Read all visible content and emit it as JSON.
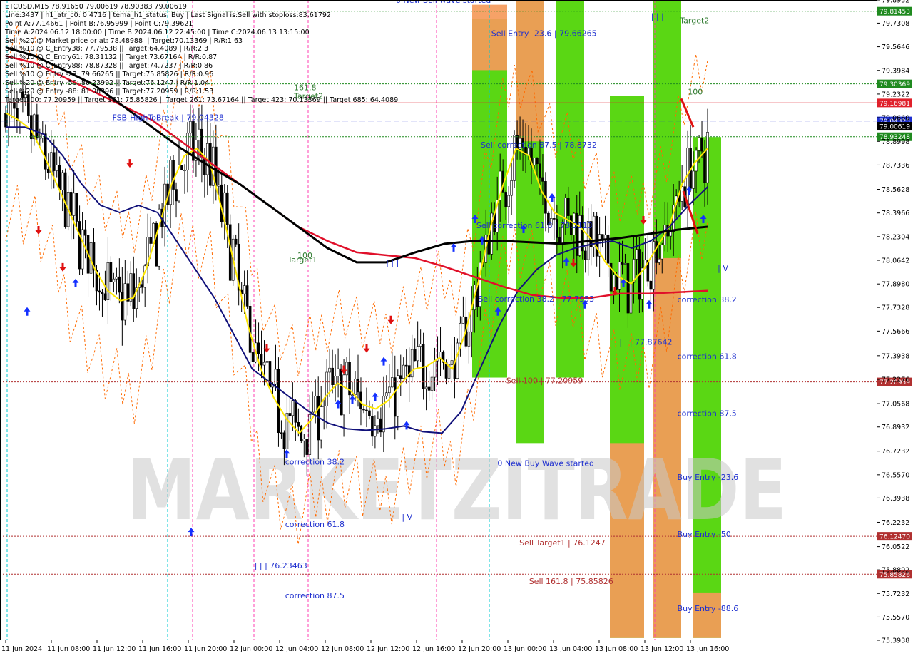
{
  "header": {
    "lines": [
      "ETCUSD,M15  78.91650 79.00619 78.90383 79.00619",
      "Line:3437 | h1_atr_c0: 0.4716 | tema_h1_status: Buy | Last Signal is:Sell with stoploss:83.61792",
      "Point A:77.14661 | Point B:76.95999 | Point C:79.39621",
      "Time A:2024.06.12 18:00:00 | Time B:2024.06.12 22:45:00 | Time C:2024.06.13 13:15:00",
      "Sell %20 @ Market price or at: 78.48988 || Target:70.13369 | R/R:1.63",
      "Sell %10 @ C_Entry38: 77.79538 || Target:64.4089 | R/R:2.3",
      "Sell %10 @ C_Entry61: 78.31132 || Target:73.67164 | R/R:0.87",
      "Sell %10 @ C_Entry88: 78.87328 || Target:74.7237 | R/R:0.86",
      "Sell %10 @ Entry -23: 79.66265 || Target:75.85826 | R/R:0.96",
      "Sell %20 @ Entry -50: 80.23992 || Target:76.1247 | R/R:1.04",
      "Sell %20 @ Entry -88: 81.08396 || Target:77.20959 | R/R:1.53",
      "Target100: 77.20959 || Target 161: 75.85826 || Target 261: 73.67164 || Target 423: 70.13369 || Target 685: 64.4089"
    ]
  },
  "top_label": "0 New Sell wave started",
  "watermark": "MARKETZITRADE",
  "chart_data": {
    "type": "candlestick",
    "symbol": "ETCUSD",
    "timeframe": "M15",
    "ylim": [
      75.3938,
      79.8932
    ],
    "y_ticks": [
      79.8932,
      79.7308,
      79.5646,
      79.3984,
      79.2322,
      79.066,
      78.8998,
      78.7336,
      78.5628,
      78.3966,
      78.2304,
      78.0642,
      77.898,
      77.7328,
      77.5666,
      77.3938,
      77.2276,
      77.0568,
      76.8932,
      76.7232,
      76.557,
      76.3938,
      76.2232,
      76.0522,
      75.8892,
      75.7232,
      75.557,
      75.3938
    ],
    "x_labels": [
      "11 Jun 2024",
      "11 Jun 08:00",
      "11 Jun 12:00",
      "11 Jun 16:00",
      "11 Jun 20:00",
      "12 Jun 00:00",
      "12 Jun 04:00",
      "12 Jun 08:00",
      "12 Jun 12:00",
      "12 Jun 16:00",
      "12 Jun 20:00",
      "13 Jun 00:00",
      "13 Jun 04:00",
      "13 Jun 08:00",
      "13 Jun 12:00",
      "13 Jun 16:00"
    ],
    "price_levels": [
      {
        "value": 79.81453,
        "label": "79.81453",
        "color": "#1f8a1f",
        "style": "dotted"
      },
      {
        "value": 79.30369,
        "label": "79.30369",
        "color": "#1f8a1f",
        "style": "dotted"
      },
      {
        "value": 79.16981,
        "label": "79.16981",
        "color": "#e0202a",
        "style": "solid"
      },
      {
        "value": 79.04328,
        "label": "79.04328",
        "color": "#1e2fcf",
        "style": "dashed"
      },
      {
        "value": 79.00619,
        "label": "79.00619",
        "color": "#000000",
        "style": "solid"
      },
      {
        "value": 78.93248,
        "label": "78.93248",
        "color": "#1f8a1f",
        "style": "dotted"
      },
      {
        "value": 77.20959,
        "label": "77.20959",
        "color": "#b03030",
        "style": "dotted"
      },
      {
        "value": 76.1247,
        "label": "76.12470",
        "color": "#b03030",
        "style": "dotted"
      },
      {
        "value": 75.85826,
        "label": "75.85826",
        "color": "#b03030",
        "style": "dotted"
      }
    ],
    "annotations": [
      {
        "text": "Sell Entry -23.6 | 79.66265",
        "x": 0.56,
        "y": 79.64,
        "color": "#1e2fcf"
      },
      {
        "text": "Sell correction 87.5 | 78.8732",
        "x": 0.548,
        "y": 78.855,
        "color": "#1e2fcf"
      },
      {
        "text": "Sell correction 61.8 | 78.3113",
        "x": 0.543,
        "y": 78.29,
        "color": "#1e2fcf"
      },
      {
        "text": "Sell correction 38.2 | 77.7953",
        "x": 0.545,
        "y": 77.775,
        "color": "#1e2fcf"
      },
      {
        "text": "Sell 100 | 77.20959",
        "x": 0.577,
        "y": 77.2,
        "color": "#b03030"
      },
      {
        "text": "Sell Target1 | 76.1247",
        "x": 0.592,
        "y": 76.06,
        "color": "#b03030"
      },
      {
        "text": "Sell 161.8 | 75.85826",
        "x": 0.603,
        "y": 75.79,
        "color": "#b03030"
      },
      {
        "text": "0 New Buy Wave started",
        "x": 0.567,
        "y": 76.62,
        "color": "#1e2fcf"
      },
      {
        "text": "correction 38.2",
        "x": 0.325,
        "y": 76.63,
        "color": "#1e2fcf"
      },
      {
        "text": "correction 61.8",
        "x": 0.325,
        "y": 76.19,
        "color": "#1e2fcf"
      },
      {
        "text": "correction 87.5",
        "x": 0.325,
        "y": 75.69,
        "color": "#1e2fcf"
      },
      {
        "text": "| | | 76.23463",
        "x": 0.29,
        "y": 75.9,
        "color": "#1e2fcf"
      },
      {
        "text": "| | | 77.87642",
        "x": 0.706,
        "y": 77.47,
        "color": "#1e2fcf"
      },
      {
        "text": "correction 38.2",
        "x": 0.772,
        "y": 77.77,
        "color": "#1e2fcf"
      },
      {
        "text": "correction 61.8",
        "x": 0.772,
        "y": 77.37,
        "color": "#1e2fcf"
      },
      {
        "text": "correction 87.5",
        "x": 0.772,
        "y": 76.97,
        "color": "#1e2fcf"
      },
      {
        "text": "Buy Entry -23.6",
        "x": 0.772,
        "y": 76.52,
        "color": "#1e2fcf"
      },
      {
        "text": "Buy Entry -50",
        "x": 0.772,
        "y": 76.12,
        "color": "#1e2fcf"
      },
      {
        "text": "Buy Entry -88.6",
        "x": 0.772,
        "y": 75.6,
        "color": "#1e2fcf"
      },
      {
        "text": "Target2",
        "x": 0.335,
        "y": 79.2,
        "color": "#2f7a2f"
      },
      {
        "text": "161.8",
        "x": 0.335,
        "y": 79.26,
        "color": "#2f7a2f"
      },
      {
        "text": "Target1",
        "x": 0.328,
        "y": 78.05,
        "color": "#2f7a2f"
      },
      {
        "text": "100",
        "x": 0.339,
        "y": 78.08,
        "color": "#2f7a2f"
      },
      {
        "text": "Target2",
        "x": 0.775,
        "y": 79.73,
        "color": "#2f7a2f"
      },
      {
        "text": "100",
        "x": 0.784,
        "y": 79.23,
        "color": "#2f7a2f"
      },
      {
        "text": "FSB-HighToBreak | 79.04328",
        "x": 0.128,
        "y": 79.05,
        "color": "#1e2fcf"
      },
      {
        "text": "| | |",
        "x": 0.44,
        "y": 78.03,
        "color": "#1e2fcf"
      },
      {
        "text": "|",
        "x": 0.272,
        "y": 77.93,
        "color": "#1e2fcf"
      },
      {
        "text": "| V",
        "x": 0.458,
        "y": 76.24,
        "color": "#1e2fcf"
      },
      {
        "text": "| | |",
        "x": 0.742,
        "y": 79.76,
        "color": "#1e2fcf"
      },
      {
        "text": "|",
        "x": 0.72,
        "y": 78.76,
        "color": "#1e2fcf"
      },
      {
        "text": "| V",
        "x": 0.818,
        "y": 77.99,
        "color": "#1e2fcf"
      }
    ],
    "series": [
      {
        "name": "",
        "color": "#ffe800",
        "values": [
          79.1,
          79.05,
          78.98,
          78.8,
          78.6,
          78.4,
          78.2,
          78.0,
          77.85,
          77.78,
          77.8,
          78.0,
          78.3,
          78.6,
          78.8,
          78.85,
          78.75,
          78.4,
          78.0,
          77.6,
          77.3,
          77.1,
          76.95,
          76.85,
          76.95,
          77.1,
          77.2,
          77.15,
          77.05,
          77.02,
          77.08,
          77.2,
          77.3,
          77.32,
          77.38,
          77.3,
          77.55,
          77.9,
          78.3,
          78.6,
          78.85,
          78.8,
          78.55,
          78.4,
          78.35,
          78.3,
          78.2,
          78.05,
          77.95,
          77.9,
          78.0,
          78.15,
          78.3,
          78.6,
          78.75,
          78.85
        ]
      },
      {
        "name": "",
        "color": "#10107a",
        "values": [
          79.0,
          79.0,
          78.95,
          78.8,
          78.6,
          78.45,
          78.4,
          78.45,
          78.4,
          78.2,
          78.0,
          77.8,
          77.55,
          77.3,
          77.2,
          77.1,
          77.0,
          76.92,
          76.88,
          76.87,
          76.88,
          76.9,
          76.86,
          76.85,
          77.0,
          77.3,
          77.6,
          77.85,
          78.0,
          78.1,
          78.15,
          78.18,
          78.2,
          78.15,
          78.2,
          78.3,
          78.45,
          78.58
        ]
      },
      {
        "name": "",
        "color": "#e0102a",
        "values": [
          79.5,
          79.45,
          79.35,
          79.25,
          79.15,
          79.05,
          78.9,
          78.75,
          78.6,
          78.45,
          78.3,
          78.2,
          78.12,
          78.1,
          78.08,
          78.02,
          77.95,
          77.88,
          77.82,
          77.8,
          77.8,
          77.83,
          77.83,
          77.84,
          77.85
        ]
      },
      {
        "name": "",
        "color": "#000000",
        "values": [
          79.56,
          79.5,
          79.4,
          79.3,
          79.15,
          79.0,
          78.85,
          78.72,
          78.6,
          78.45,
          78.3,
          78.15,
          78.05,
          78.05,
          78.12,
          78.18,
          78.2,
          78.2,
          78.19,
          78.18,
          78.2,
          78.22,
          78.25,
          78.28,
          78.3
        ]
      }
    ],
    "zones": [
      {
        "color": "#4cd400",
        "y": [
          77.24,
          79.76
        ]
      },
      {
        "color": "#f59a5a",
        "y": [
          79.4,
          79.86
        ]
      },
      {
        "color": "#4cd400",
        "y": [
          76.78,
          79.89
        ]
      },
      {
        "color": "#f59a5a",
        "y": [
          78.9,
          79.89
        ]
      },
      {
        "color": "#4cd400",
        "y": [
          77.24,
          79.89
        ]
      },
      {
        "color": "#4cd400",
        "y": [
          75.41,
          79.22
        ]
      },
      {
        "color": "#f59a5a",
        "y": [
          75.41,
          76.78
        ]
      },
      {
        "color": "#4cd400",
        "y": [
          75.41,
          79.89
        ]
      },
      {
        "color": "#f59a5a",
        "y": [
          75.41,
          78.08
        ]
      },
      {
        "color": "#4cd400",
        "y": [
          75.41,
          78.93
        ]
      },
      {
        "color": "#f59a5a",
        "y": [
          75.41,
          75.73
        ]
      }
    ]
  }
}
